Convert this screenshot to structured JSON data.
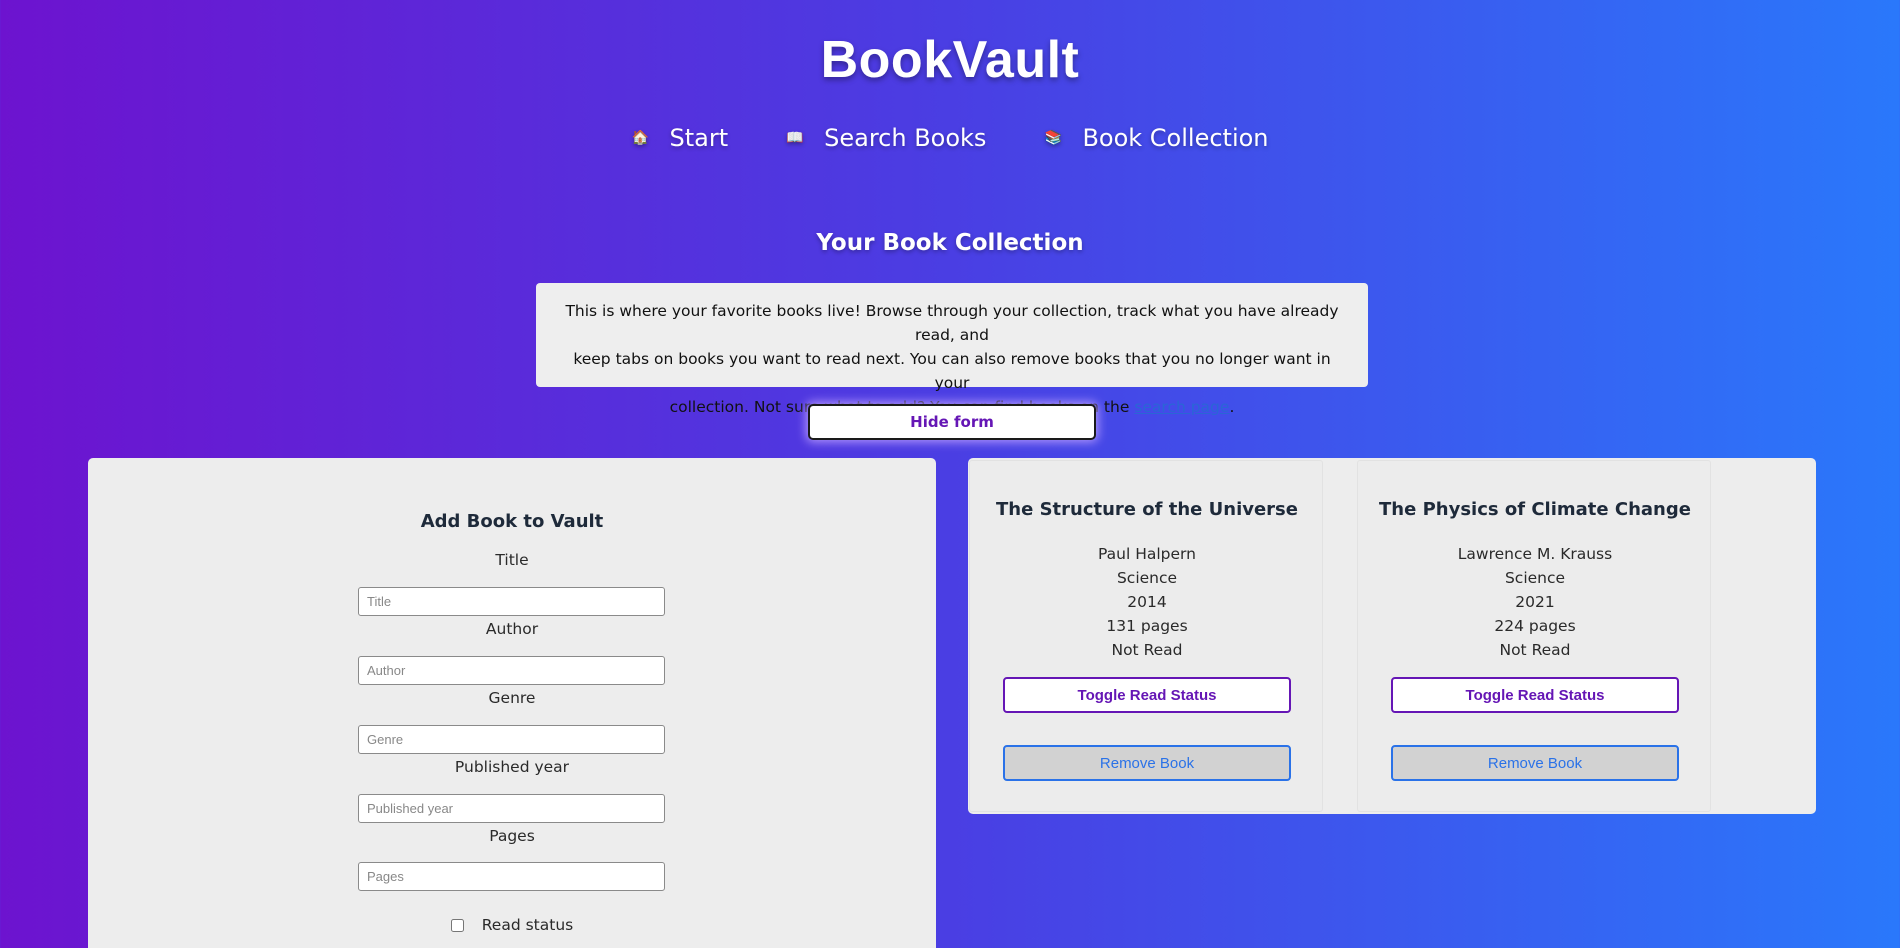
{
  "app": {
    "title": "BookVault"
  },
  "nav": {
    "items": [
      {
        "icon": "home-icon",
        "glyph": "🏠",
        "label": "Start"
      },
      {
        "icon": "book-open-icon",
        "glyph": "📖",
        "label": "Search Books"
      },
      {
        "icon": "books-icon",
        "glyph": "📚",
        "label": "Book Collection"
      }
    ]
  },
  "collection": {
    "heading": "Your Book Collection",
    "intro_line1": "This is where your favorite books live! Browse through your collection, track what you have already read, and",
    "intro_line2": "keep tabs on books you want to read next. You can also remove books that you no longer want in your",
    "intro_line3_before": "collection. Not sure what to add? You can find books on the ",
    "intro_link": "search page",
    "intro_line3_after": ".",
    "toggle_form_label": "Hide form"
  },
  "form": {
    "title": "Add Book to Vault",
    "fields": [
      {
        "label": "Title",
        "placeholder": "Title",
        "value": ""
      },
      {
        "label": "Author",
        "placeholder": "Author",
        "value": ""
      },
      {
        "label": "Genre",
        "placeholder": "Genre",
        "value": ""
      },
      {
        "label": "Published year",
        "placeholder": "Published year",
        "value": ""
      },
      {
        "label": "Pages",
        "placeholder": "Pages",
        "value": ""
      }
    ],
    "read_status_label": "Read status",
    "read_status_checked": false
  },
  "books": [
    {
      "title": "The Structure of the Universe",
      "author": "Paul Halpern",
      "genre": "Science",
      "year": "2014",
      "pages": "131 pages",
      "status": "Not Read",
      "toggle_label": "Toggle Read Status",
      "remove_label": "Remove Book"
    },
    {
      "title": "The Physics of Climate Change",
      "author": "Lawrence M. Krauss",
      "genre": "Science",
      "year": "2021",
      "pages": "224 pages",
      "status": "Not Read",
      "toggle_label": "Toggle Read Status",
      "remove_label": "Remove Book"
    }
  ],
  "colors": {
    "gradient_start": "#6d13cf",
    "gradient_end": "#2a78fb",
    "accent_purple": "#6516b5",
    "accent_blue": "#2a72e8"
  }
}
